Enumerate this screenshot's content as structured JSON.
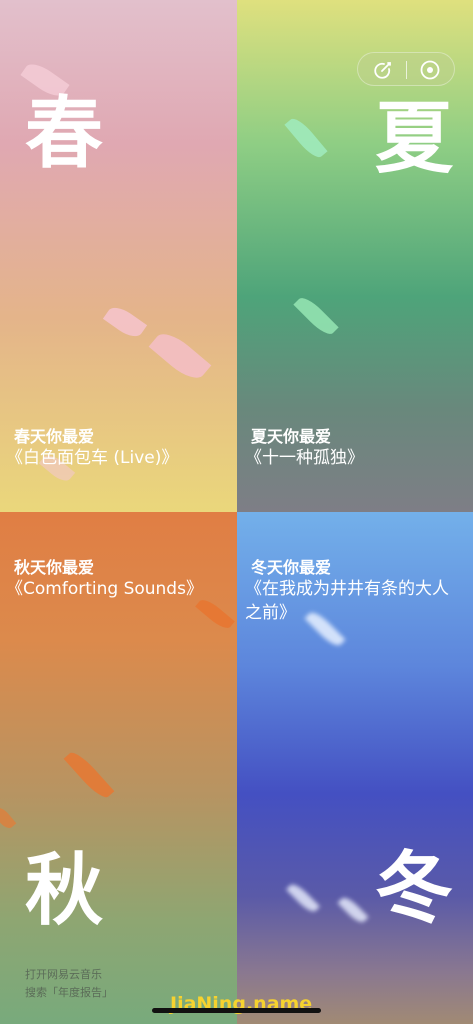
{
  "capsule": {
    "share_icon": "share-arrow-icon",
    "close_icon": "target-close-icon"
  },
  "spring": {
    "season": "春",
    "label": "春天你最爱",
    "song": "《白色面包车 (Live)》"
  },
  "summer": {
    "season": "夏",
    "label": "夏天你最爱",
    "song": "《十一种孤独》"
  },
  "autumn": {
    "season": "秋",
    "label": "秋天你最爱",
    "song": "《Comforting Sounds》"
  },
  "winter": {
    "season": "冬",
    "label": "冬天你最爱",
    "song_line1": "《在我成为井井有条的大人",
    "song_line2": "之前》"
  },
  "footer": {
    "line1": "打开网易云音乐",
    "line2": "搜索「年度报告」"
  },
  "watermark": "JiaNing.name",
  "colors": {
    "spring_top": "#e2c0cc",
    "spring_bottom": "#ead77b",
    "summer_top": "#dfe07e",
    "summer_mid": "#4ea47a",
    "autumn_top": "#e07e44",
    "autumn_bottom": "#78aa7c",
    "winter_top": "#73b0ea",
    "winter_mid": "#4450c2",
    "watermark": "#f6d22f"
  }
}
